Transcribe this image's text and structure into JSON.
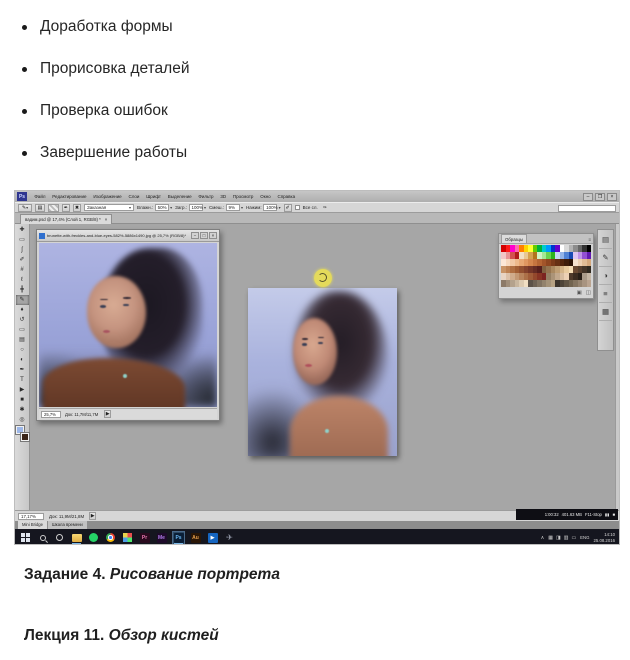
{
  "document": {
    "bullets": [
      "Доработка формы",
      "Прорисовка деталей",
      "Проверка ошибок",
      "Завершение работы"
    ],
    "captions": [
      {
        "prefix": "Задание 4.",
        "italic": " Рисование портрета"
      },
      {
        "prefix": "Лекция 11.",
        "italic": " Обзор кистей"
      }
    ]
  },
  "photoshop": {
    "app_label": "Ps",
    "menus": [
      "Файл",
      "Редактирование",
      "Изображение",
      "Слои",
      "Шрифт",
      "Выделение",
      "Фильтр",
      "3D",
      "Просмотр",
      "Окно",
      "Справка"
    ],
    "window_controls": {
      "minimize": "–",
      "restore": "❐",
      "close": "×"
    },
    "options_bar": {
      "brush_glyph": "✎",
      "preset_dropdown": "Заказная",
      "fields": [
        {
          "label": "Влажн.:",
          "value": "50%"
        },
        {
          "label": "Загр.:",
          "value": "100%"
        },
        {
          "label": "Смеш.:",
          "value": "9%"
        },
        {
          "label": "Нажим:",
          "value": "100%"
        }
      ],
      "sample_all_layers_label": "Все сл.",
      "airbrush_glyph": "✐",
      "pressure_glyph": "✑"
    },
    "document_tab": "вадим.psd @ 17,4% (Слой 1, RGB/8) *",
    "document_tab_close": "×",
    "reference_window": {
      "title": "brunette-with-freckles-and-blue-eyes-582%-5886x1490.jpg @ 25,7% (RGB/8)*",
      "zoom": "25,7%",
      "doc_size": "Док: 11,7M/11,7M",
      "arrow": "▶"
    },
    "status_bar": {
      "zoom": "17,17%",
      "doc_size": "Док: 11,9M/21,8M",
      "arrow": "▶"
    },
    "bottom_tabs": [
      "Mini Bridge",
      "Шкала времени"
    ],
    "swatches_panel": {
      "title": "Образцы",
      "head_icons": "≡",
      "new_swatch_glyph": "▣",
      "delete_swatch_glyph": "◫",
      "rows": [
        [
          "#d40000",
          "#ff1a1a",
          "#ff00cc",
          "#ff66b2",
          "#ff7f00",
          "#ffd400",
          "#ffff33",
          "#66cc00",
          "#00b33c",
          "#00cccc",
          "#0099ff",
          "#0033cc",
          "#6600cc",
          "#ffffff",
          "#d9d9d9",
          "#b3b3b3",
          "#8c8c8c",
          "#666666",
          "#333333",
          "#000000"
        ],
        [
          "#f2c6c6",
          "#e89494",
          "#d45050",
          "#b31b1b",
          "#f2e0c6",
          "#e8c894",
          "#d4a050",
          "#b3741b",
          "#d2f2c6",
          "#a4e894",
          "#6ad450",
          "#2fb31b",
          "#c6d8f2",
          "#94b4e8",
          "#5082d4",
          "#1b4bb3",
          "#e0c6f2",
          "#c094e8",
          "#9350d4",
          "#641bb3"
        ],
        [
          "#fce8d8",
          "#f7d9bf",
          "#f2c9a6",
          "#edb98c",
          "#e8a873",
          "#e09760",
          "#d4864e",
          "#c67540",
          "#b56534",
          "#a3552a",
          "#8f4721",
          "#7a3a1a",
          "#663014",
          "#52260f",
          "#3f1d0b",
          "#2e1507",
          "#f7e3cf",
          "#edd0b2",
          "#e0bc96",
          "#d4a87c"
        ],
        [
          "#c99467",
          "#bd8153",
          "#b06f42",
          "#a25e34",
          "#935030",
          "#84422c",
          "#753628",
          "#662c24",
          "#571f1c",
          "#82603f",
          "#96744f",
          "#aa8960",
          "#bf9e73",
          "#d4b488",
          "#e8ca9e",
          "#f5ddb5",
          "#6b4a32",
          "#57402e",
          "#433528",
          "#2f2a20"
        ],
        [
          "#e8d4c4",
          "#dcc0a8",
          "#d0ac8c",
          "#c49873",
          "#b8845c",
          "#ac7048",
          "#a05c38",
          "#94482c",
          "#883424",
          "#7c2420",
          "#958064",
          "#ab9478",
          "#c1a88c",
          "#d7bca0",
          "#ecd0b4",
          "#4f3a2a",
          "#3b2c20",
          "#271e16",
          "#aa9c8a",
          "#c4b6a4"
        ],
        [
          "#8c7a68",
          "#a08e7a",
          "#b4a28c",
          "#c8b69e",
          "#dccab0",
          "#f0dec2",
          "#5c5248",
          "#6e6254",
          "#807260",
          "#92826c",
          "#a49278",
          "#b6a284",
          "#3c342c",
          "#4e4438",
          "#605444",
          "#726450",
          "#847460",
          "#968470",
          "#a89480",
          "#baa490"
        ]
      ]
    },
    "tools": [
      {
        "name": "move-tool-icon",
        "glyph": "✚"
      },
      {
        "name": "marquee-tool-icon",
        "glyph": "▭"
      },
      {
        "name": "lasso-tool-icon",
        "glyph": "ʃ"
      },
      {
        "name": "quick-select-tool-icon",
        "glyph": "✐"
      },
      {
        "name": "crop-tool-icon",
        "glyph": "#"
      },
      {
        "name": "eyedropper-tool-icon",
        "glyph": "ℓ"
      },
      {
        "name": "healing-brush-tool-icon",
        "glyph": "╋"
      },
      {
        "name": "brush-tool-icon",
        "glyph": "✎",
        "active": true
      },
      {
        "name": "clone-stamp-tool-icon",
        "glyph": "♦"
      },
      {
        "name": "history-brush-tool-icon",
        "glyph": "↺"
      },
      {
        "name": "eraser-tool-icon",
        "glyph": "▭"
      },
      {
        "name": "gradient-tool-icon",
        "glyph": "▤"
      },
      {
        "name": "blur-tool-icon",
        "glyph": "○"
      },
      {
        "name": "dodge-tool-icon",
        "glyph": "◐"
      },
      {
        "name": "pen-tool-icon",
        "glyph": "✒"
      },
      {
        "name": "type-tool-icon",
        "glyph": "T"
      },
      {
        "name": "path-select-tool-icon",
        "glyph": "▶"
      },
      {
        "name": "shape-tool-icon",
        "glyph": "■"
      },
      {
        "name": "hand-tool-icon",
        "glyph": "✱"
      },
      {
        "name": "zoom-tool-icon",
        "glyph": "◎"
      }
    ],
    "colors": {
      "foreground": "#9db7e8",
      "background": "#3a2417"
    },
    "dock_icons": [
      {
        "name": "brush-presets-panel-icon",
        "glyph": "▤"
      },
      {
        "name": "brush-panel-icon",
        "glyph": "✎"
      },
      {
        "name": "clone-source-panel-icon",
        "glyph": "◑"
      },
      {
        "name": "adjustments-panel-icon",
        "glyph": "≡"
      },
      {
        "name": "layers-panel-icon",
        "glyph": "▦"
      }
    ]
  },
  "recorder_overlay": {
    "time": "1:00:32",
    "size": "401.63 MB",
    "hotkey": "F11-Stop",
    "pause": "▮▮",
    "stop": "■"
  },
  "taskbar": {
    "icons": [
      {
        "name": "start-button",
        "kind": "start"
      },
      {
        "name": "search-button",
        "kind": "search"
      },
      {
        "name": "task-view-button",
        "kind": "ring"
      },
      {
        "name": "file-explorer-icon",
        "kind": "folder",
        "active": true
      },
      {
        "name": "whatsapp-icon",
        "kind": "circle",
        "color": "#25d366"
      },
      {
        "name": "chrome-icon",
        "kind": "chrome"
      },
      {
        "name": "colorful-app-icon",
        "kind": "mosaic"
      },
      {
        "name": "premiere-icon",
        "kind": "square",
        "color": "#2a0a1e",
        "label": "Pr",
        "label_color": "#e879b0"
      },
      {
        "name": "media-encoder-icon",
        "kind": "square",
        "color": "#1e0a2a",
        "label": "Me",
        "label_color": "#b07be8"
      },
      {
        "name": "photoshop-icon",
        "kind": "square",
        "color": "#0a1e36",
        "label": "Ps",
        "label_color": "#6bb8f2",
        "active": true,
        "focused": true
      },
      {
        "name": "audition-icon",
        "kind": "square",
        "color": "#2a1606",
        "label": "Au",
        "label_color": "#e8a04e"
      },
      {
        "name": "media-player-icon",
        "kind": "square",
        "color": "#1565c0",
        "label": "▶",
        "label_color": "#ffffff"
      },
      {
        "name": "send-app-icon",
        "kind": "plane",
        "label": "✈"
      }
    ],
    "tray": {
      "chevron": "∧",
      "glyphs": [
        "▦",
        "◨",
        "▥",
        "▭"
      ],
      "lang": "ENG",
      "time": "14:10",
      "date": "25.08.2016"
    }
  }
}
